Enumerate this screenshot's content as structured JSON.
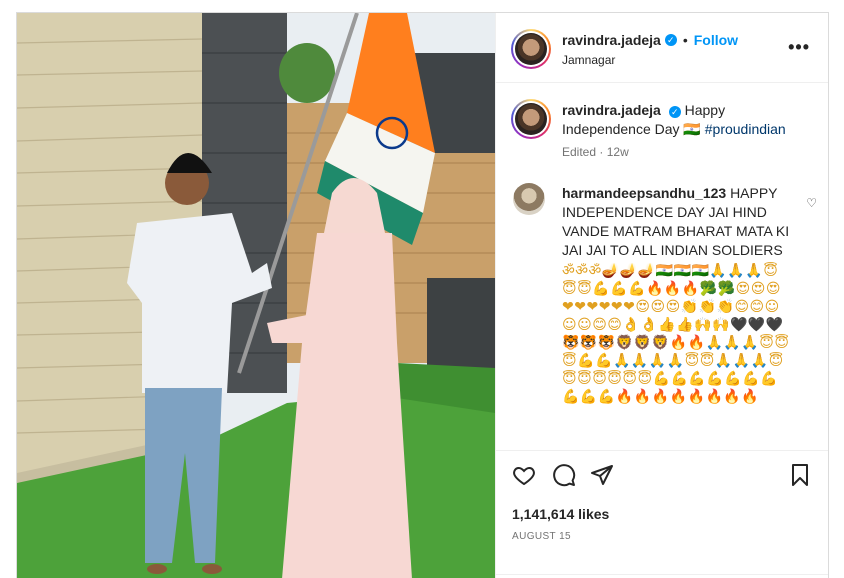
{
  "post": {
    "author": {
      "username": "ravindra.jadeja",
      "verified_mark": "✓",
      "location": "Jamnagar"
    },
    "header": {
      "dot": "•",
      "follow_label": "Follow",
      "more_label": "•••"
    },
    "caption": {
      "username": "ravindra.jadeja",
      "text": "Happy Independence Day 🇮🇳 ",
      "hashtag": "#proudindian",
      "edited": "Edited",
      "meta_dot": "·",
      "age": "12w"
    },
    "comment": {
      "username": "harmandeepsandhu_123",
      "text": "HAPPY INDEPENDENCE DAY JAI HIND VANDE MATRAM BHARAT MATA KI JAI JAI TO ALL INDIAN SOLDIERS",
      "emojis": "ॐॐॐ🪔🪔🪔🇮🇳🇮🇳🇮🇳🙏🙏🙏😇😇😇💪💪💪🔥🔥🔥🥦🥦😍😍😍❤❤❤❤❤❤😍😍😍👏👏👏😊😊☺☺☺😊😊👌👌👍👍🙌🙌🖤🖤🖤🐯🐯🐯🦁🦁🦁🔥🔥🙏🙏🙏😇😇😇💪💪🙏🙏🙏🙏😇😇🙏🙏🙏😇😇😇😇😇😇😇💪💪💪💪💪💪💪💪💪💪🔥🔥🔥🔥🔥🔥🔥🔥",
      "heart": "♡"
    },
    "actions": {
      "likes": "1,141,614 likes",
      "date": "AUGUST 15"
    },
    "colors": {
      "accent": "#0095f6",
      "hashtag": "#00376b",
      "muted": "#737373",
      "flag_saffron": "#ff7f1e",
      "flag_green": "#1f8a6b",
      "chakra": "#0b3a8c"
    }
  }
}
